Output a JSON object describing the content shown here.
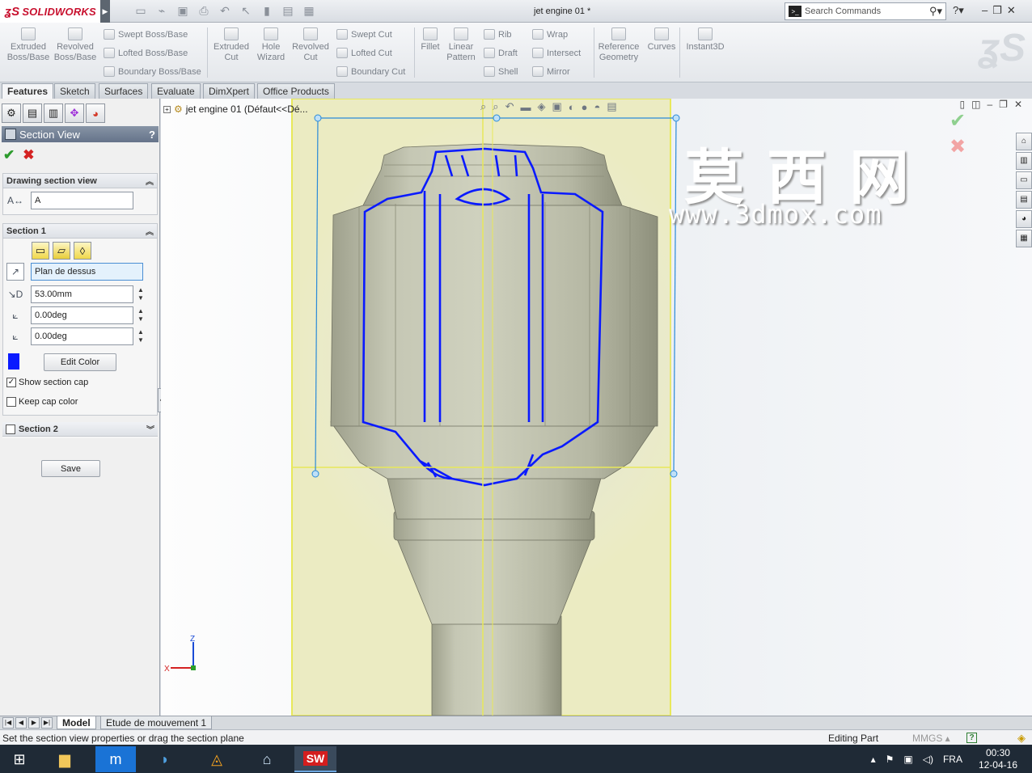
{
  "app": {
    "brand": "SOLIDWORKS",
    "document_title": "jet engine 01 *"
  },
  "search": {
    "placeholder": "Search Commands"
  },
  "ribbon": {
    "extruded_boss": "Extruded\nBoss/Base",
    "revolved_boss": "Revolved\nBoss/Base",
    "swept_boss": "Swept Boss/Base",
    "lofted_boss": "Lofted Boss/Base",
    "boundary_boss": "Boundary Boss/Base",
    "extruded_cut": "Extruded\nCut",
    "hole_wizard": "Hole\nWizard",
    "revolved_cut": "Revolved\nCut",
    "swept_cut": "Swept Cut",
    "lofted_cut": "Lofted Cut",
    "boundary_cut": "Boundary Cut",
    "fillet": "Fillet",
    "linear_pattern": "Linear\nPattern",
    "rib": "Rib",
    "draft": "Draft",
    "shell": "Shell",
    "wrap": "Wrap",
    "intersect": "Intersect",
    "mirror": "Mirror",
    "reference_geometry": "Reference\nGeometry",
    "curves": "Curves",
    "instant3d": "Instant3D"
  },
  "cm_tabs": [
    "Features",
    "Sketch",
    "Surfaces",
    "Evaluate",
    "DimXpert",
    "Office Products"
  ],
  "property_manager": {
    "title": "Section View",
    "help": "?",
    "drawing_section_view": {
      "label": "Drawing section view",
      "name_value": "A"
    },
    "section1": {
      "label": "Section 1",
      "plane_value": "Plan de dessus",
      "offset_value": "53.00mm",
      "angle1_value": "0.00deg",
      "angle2_value": "0.00deg",
      "edit_color_label": "Edit Color",
      "section_color": "#0a1aff",
      "show_section_cap": {
        "label": "Show section cap",
        "checked": true
      },
      "keep_cap_color": {
        "label": "Keep cap color",
        "checked": false
      }
    },
    "section2": {
      "label": "Section 2",
      "checked": false
    },
    "save_label": "Save"
  },
  "feature_tree": {
    "root_label": "jet engine 01  (Défaut<<Dé..."
  },
  "watermark": {
    "chinese": "莫西网",
    "url": "www.3dmox.com"
  },
  "triad": {
    "z_label": "Z",
    "x_label": "X"
  },
  "model_tabs": [
    "Model",
    "Etude de mouvement 1"
  ],
  "status": {
    "message": "Set the section view properties or drag the section plane",
    "mode": "Editing Part",
    "units": "MMGS"
  },
  "taskbar": {
    "language": "FRA",
    "time": "00:30",
    "date": "12-04-16"
  },
  "colors": {
    "section_plane_fill": "#ebebc2",
    "section_plane_border": "#e8e85a",
    "model_body": "#c3c6b2",
    "section_outline": "#0a1aff",
    "selection_box": "#2a8ad8"
  }
}
